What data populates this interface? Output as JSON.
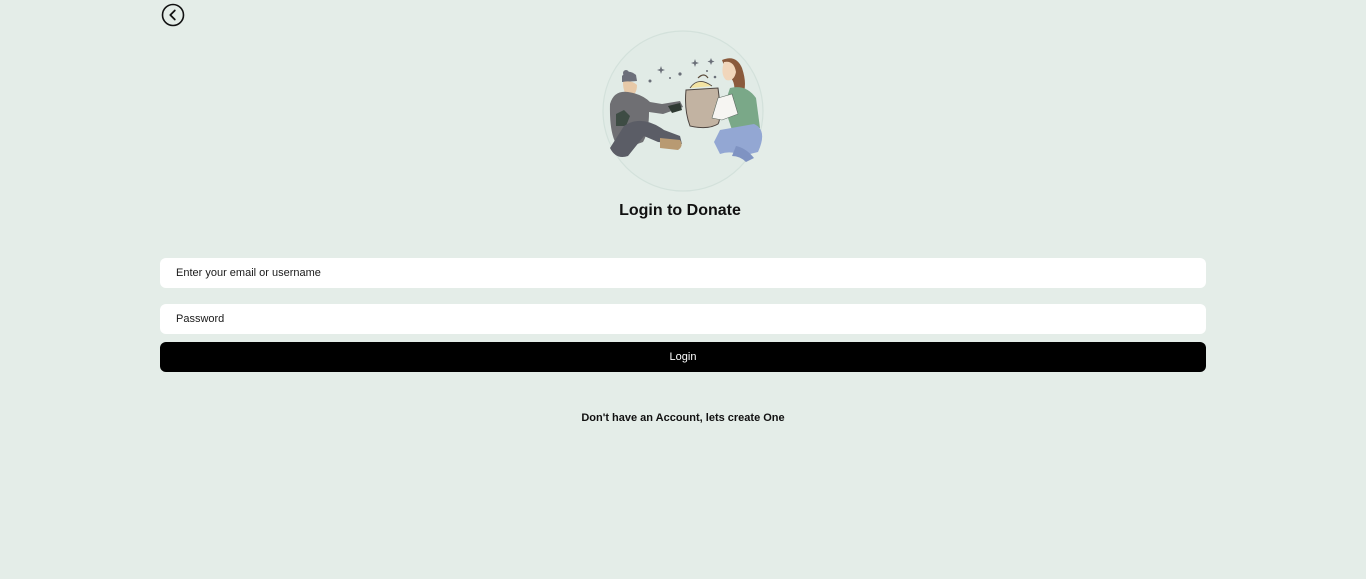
{
  "header": {
    "back_icon": "chevron-left-circle-icon"
  },
  "hero": {
    "illustration": "donation-illustration"
  },
  "form": {
    "title": "Login to Donate",
    "email_placeholder": "Enter your email or username",
    "email_value": "",
    "password_placeholder": "Password",
    "password_value": "",
    "login_label": "Login",
    "signup_text": "Don't have an Account, lets create One"
  },
  "colors": {
    "background": "#e4ede8",
    "button": "#000000",
    "button_text": "#ffffff"
  }
}
